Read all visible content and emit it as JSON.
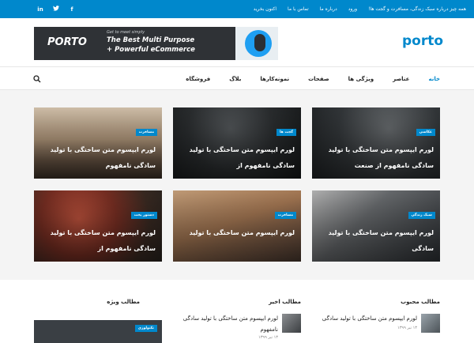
{
  "topbar": {
    "menu": [
      "همه چیز درباره سبک زندگی، مسافرت و گجت ها!",
      "ورود",
      "درباره ما",
      "تماس با ما",
      "اکنون بخرید"
    ],
    "social": [
      "f",
      "t",
      "in"
    ]
  },
  "banner": {
    "logo": "PORTO",
    "sub": "Get to meet simply",
    "line1": "The Best Multi Purpose",
    "line2": "+ Powerful eCommerce"
  },
  "logo": "porto",
  "nav": {
    "items": [
      "خانه",
      "عناصر",
      "ویژگی ها",
      "صفحات",
      "نمونه‌کارها",
      "بلاگ",
      "فروشگاه"
    ],
    "active": 0
  },
  "posts": [
    {
      "badge": "عکاسی",
      "title": "لورم ایپسوم متن ساختگی با تولید سادگی نامفهوم از صنعت"
    },
    {
      "badge": "گجت ها",
      "title": "لورم ایپسوم متن ساختگی با تولید سادگی نامفهوم از"
    },
    {
      "badge": "مسافرت",
      "title": "لورم ایپسوم متن ساختگی با تولید سادگی نامفهوم"
    },
    {
      "badge": "سبک زندگی",
      "title": "لورم ایپسوم متن ساختگی با تولید سادگی"
    },
    {
      "badge": "مسافرت",
      "title": "لورم ایپسوم متن ساختگی با تولید"
    },
    {
      "badge": "دستور پخت",
      "title": "لورم ایپسوم متن ساختگی با تولید سادگی نامفهوم از"
    }
  ],
  "bottom": {
    "popular_title": "مطالب محبوب",
    "recent_title": "مطالب اخیر",
    "featured_title": "مطالب ویژه",
    "popular_item": {
      "title": "لورم ایپسوم متن ساختگی با تولید سادگی",
      "date": "۱۳ تیر ۱۳۹۹"
    },
    "recent_item": {
      "title": "لورم ایپسوم متن ساختگی با تولید سادگی نامفهوم",
      "date": "۱۳ تیر ۱۳۹۹"
    },
    "featured_badge": "تکنولوژی"
  },
  "colors": {
    "accent": "#0088cc"
  }
}
